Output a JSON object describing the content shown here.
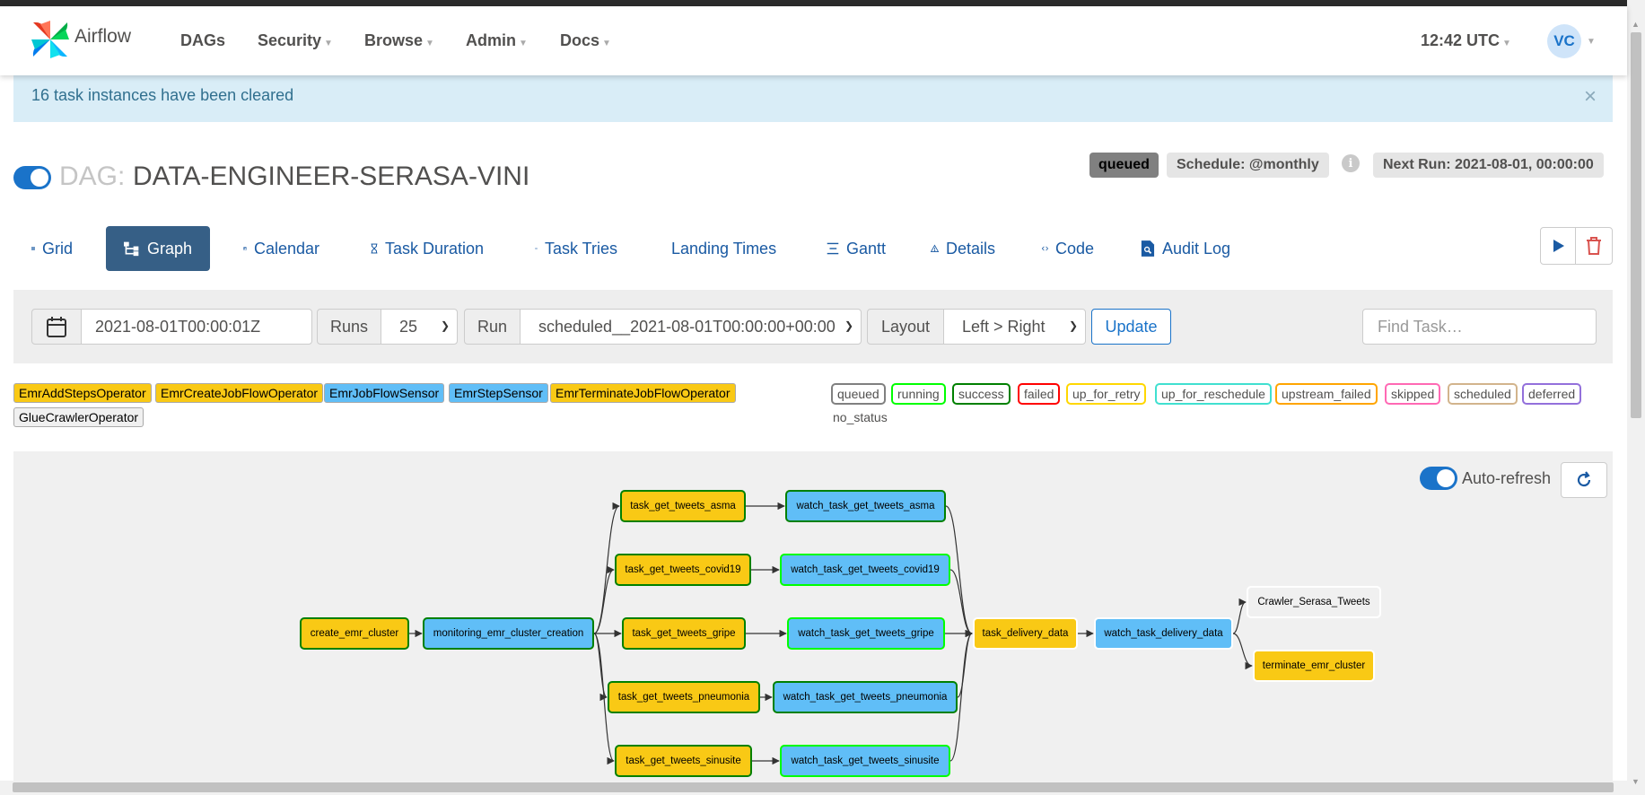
{
  "brand": {
    "name": "Airflow"
  },
  "nav": {
    "items": [
      {
        "label": "DAGs",
        "dropdown": false
      },
      {
        "label": "Security",
        "dropdown": true
      },
      {
        "label": "Browse",
        "dropdown": true
      },
      {
        "label": "Admin",
        "dropdown": true
      },
      {
        "label": "Docs",
        "dropdown": true
      }
    ],
    "clock": "12:42 UTC",
    "user_initials": "VC"
  },
  "alert": {
    "message": "16 task instances have been cleared",
    "close": "×"
  },
  "dag": {
    "prefix": "DAG:",
    "name": "DATA-ENGINEER-SERASA-VINI",
    "state": "queued",
    "schedule": "Schedule: @monthly",
    "info": "i",
    "next_run": "Next Run: 2021-08-01, 00:00:00",
    "paused": false
  },
  "tabs": [
    {
      "label": "Grid",
      "icon": "grid-icon"
    },
    {
      "label": "Graph",
      "icon": "graph-icon",
      "active": true
    },
    {
      "label": "Calendar",
      "icon": "calendar-icon"
    },
    {
      "label": "Task Duration",
      "icon": "hourglass-icon"
    },
    {
      "label": "Task Tries",
      "icon": "repeat-icon"
    },
    {
      "label": "Landing Times",
      "icon": "plane-landing-icon"
    },
    {
      "label": "Gantt",
      "icon": "gantt-icon"
    },
    {
      "label": "Details",
      "icon": "warning-triangle-icon"
    },
    {
      "label": "Code",
      "icon": "code-icon"
    },
    {
      "label": "Audit Log",
      "icon": "file-search-icon"
    }
  ],
  "filters": {
    "date_value": "2021-08-01T00:00:01Z",
    "runs_label": "Runs",
    "runs_value": "25",
    "run_label": "Run",
    "run_value": "scheduled__2021-08-01T00:00:00+00:00",
    "layout_label": "Layout",
    "layout_value": "Left > Right",
    "update_label": "Update",
    "find_placeholder": "Find Task…"
  },
  "operators": [
    {
      "label": "EmrAddStepsOperator",
      "color": "#f9c915"
    },
    {
      "label": "EmrCreateJobFlowOperator",
      "color": "#f9c915"
    },
    {
      "label": "EmrJobFlowSensor",
      "color": "#60bef7"
    },
    {
      "label": "EmrStepSensor",
      "color": "#60bef7"
    },
    {
      "label": "EmrTerminateJobFlowOperator",
      "color": "#f9c915"
    },
    {
      "label": "GlueCrawlerOperator",
      "color": "#f0f0f0"
    }
  ],
  "states": [
    {
      "label": "queued",
      "color": "#808080"
    },
    {
      "label": "running",
      "color": "#00ff00"
    },
    {
      "label": "success",
      "color": "#008000"
    },
    {
      "label": "failed",
      "color": "#ff0000"
    },
    {
      "label": "up_for_retry",
      "color": "#ffd700"
    },
    {
      "label": "up_for_reschedule",
      "color": "#40e0d0"
    },
    {
      "label": "upstream_failed",
      "color": "#ffa500"
    },
    {
      "label": "skipped",
      "color": "#ff69b4"
    },
    {
      "label": "scheduled",
      "color": "#d2b48c"
    },
    {
      "label": "deferred",
      "color": "#9370db"
    }
  ],
  "no_status_label": "no_status",
  "graph": {
    "auto_refresh_label": "Auto-refresh",
    "auto_refresh": true,
    "nodes": [
      {
        "id": "create_emr_cluster",
        "label": "create_emr_cluster",
        "fill": "#f9c915",
        "status_color": "#008000"
      },
      {
        "id": "monitoring_emr_cluster_creation",
        "label": "monitoring_emr_cluster_creation",
        "fill": "#60bef7",
        "status_color": "#008000"
      },
      {
        "id": "task_get_tweets_asma",
        "label": "task_get_tweets_asma",
        "fill": "#f9c915",
        "status_color": "#008000"
      },
      {
        "id": "task_get_tweets_covid19",
        "label": "task_get_tweets_covid19",
        "fill": "#f9c915",
        "status_color": "#008000"
      },
      {
        "id": "task_get_tweets_gripe",
        "label": "task_get_tweets_gripe",
        "fill": "#f9c915",
        "status_color": "#008000"
      },
      {
        "id": "task_get_tweets_pneumonia",
        "label": "task_get_tweets_pneumonia",
        "fill": "#f9c915",
        "status_color": "#008000"
      },
      {
        "id": "task_get_tweets_sinusite",
        "label": "task_get_tweets_sinusite",
        "fill": "#f9c915",
        "status_color": "#008000"
      },
      {
        "id": "watch_task_get_tweets_asma",
        "label": "watch_task_get_tweets_asma",
        "fill": "#60bef7",
        "status_color": "#008000"
      },
      {
        "id": "watch_task_get_tweets_covid19",
        "label": "watch_task_get_tweets_covid19",
        "fill": "#60bef7",
        "status_color": "#00ff00"
      },
      {
        "id": "watch_task_get_tweets_gripe",
        "label": "watch_task_get_tweets_gripe",
        "fill": "#60bef7",
        "status_color": "#00ff00"
      },
      {
        "id": "watch_task_get_tweets_pneumonia",
        "label": "watch_task_get_tweets_pneumonia",
        "fill": "#60bef7",
        "status_color": "#008000"
      },
      {
        "id": "watch_task_get_tweets_sinusite",
        "label": "watch_task_get_tweets_sinusite",
        "fill": "#60bef7",
        "status_color": "#00ff00"
      },
      {
        "id": "task_delivery_data",
        "label": "task_delivery_data",
        "fill": "#f9c915",
        "status_color": "#ffffff"
      },
      {
        "id": "watch_task_delivery_data",
        "label": "watch_task_delivery_data",
        "fill": "#60bef7",
        "status_color": "#ffffff"
      },
      {
        "id": "Crawler_Serasa_Tweets",
        "label": "Crawler_Serasa_Tweets",
        "fill": "#f0f0f0",
        "status_color": "#ffffff"
      },
      {
        "id": "terminate_emr_cluster",
        "label": "terminate_emr_cluster",
        "fill": "#f9c915",
        "status_color": "#ffffff"
      }
    ],
    "edges": [
      [
        "create_emr_cluster",
        "monitoring_emr_cluster_creation"
      ],
      [
        "monitoring_emr_cluster_creation",
        "task_get_tweets_asma"
      ],
      [
        "monitoring_emr_cluster_creation",
        "task_get_tweets_covid19"
      ],
      [
        "monitoring_emr_cluster_creation",
        "task_get_tweets_gripe"
      ],
      [
        "monitoring_emr_cluster_creation",
        "task_get_tweets_pneumonia"
      ],
      [
        "monitoring_emr_cluster_creation",
        "task_get_tweets_sinusite"
      ],
      [
        "task_get_tweets_asma",
        "watch_task_get_tweets_asma"
      ],
      [
        "task_get_tweets_covid19",
        "watch_task_get_tweets_covid19"
      ],
      [
        "task_get_tweets_gripe",
        "watch_task_get_tweets_gripe"
      ],
      [
        "task_get_tweets_pneumonia",
        "watch_task_get_tweets_pneumonia"
      ],
      [
        "task_get_tweets_sinusite",
        "watch_task_get_tweets_sinusite"
      ],
      [
        "watch_task_get_tweets_asma",
        "task_delivery_data"
      ],
      [
        "watch_task_get_tweets_covid19",
        "task_delivery_data"
      ],
      [
        "watch_task_get_tweets_gripe",
        "task_delivery_data"
      ],
      [
        "watch_task_get_tweets_pneumonia",
        "task_delivery_data"
      ],
      [
        "watch_task_get_tweets_sinusite",
        "task_delivery_data"
      ],
      [
        "task_delivery_data",
        "watch_task_delivery_data"
      ],
      [
        "watch_task_delivery_data",
        "Crawler_Serasa_Tweets"
      ],
      [
        "watch_task_delivery_data",
        "terminate_emr_cluster"
      ]
    ]
  }
}
